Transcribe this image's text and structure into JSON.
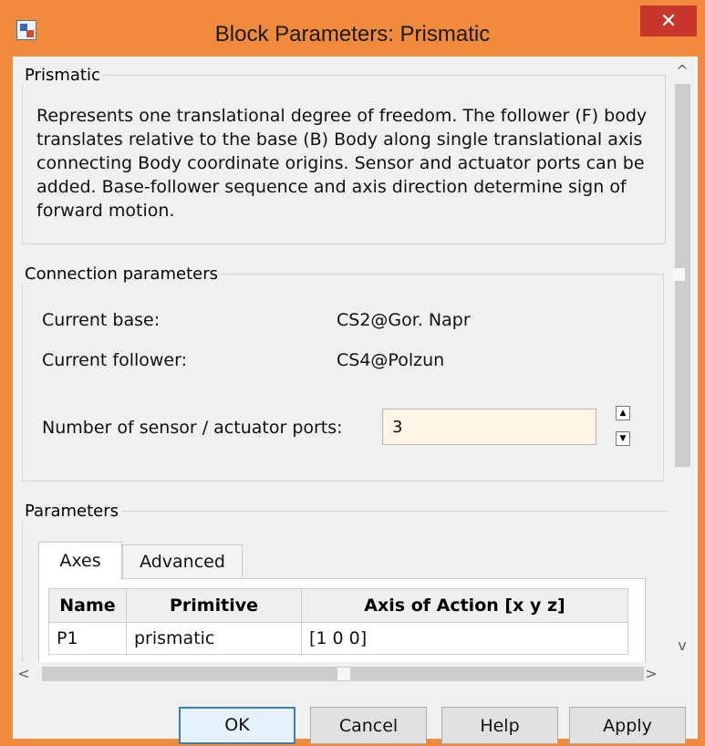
{
  "window": {
    "title": "Block Parameters: Prismatic",
    "close_glyph": "✕",
    "icon": "simulink-block-icon"
  },
  "block": {
    "group_label": "Prismatic",
    "description": "Represents one translational degree of freedom. The follower (F) body translates relative to the base (B) Body along single translational axis connecting Body coordinate origins. Sensor and actuator ports can be added. Base-follower sequence and axis direction determine sign of forward motion."
  },
  "connection": {
    "group_label": "Connection parameters",
    "base_label": "Current base:",
    "base_value": "CS2@Gor. Napr",
    "follower_label": "Current follower:",
    "follower_value": "CS4@Polzun",
    "ports_label": "Number of sensor / actuator ports:",
    "ports_value": "3",
    "spin_up": "▲",
    "spin_down": "▼"
  },
  "parameters": {
    "group_label": "Parameters",
    "tabs": [
      {
        "label": "Axes",
        "active": true
      },
      {
        "label": "Advanced",
        "active": false
      }
    ],
    "table": {
      "columns": [
        "Name",
        "Primitive",
        "Axis of Action [x y z]"
      ],
      "rows": [
        [
          "P1",
          "prismatic",
          "[1 0 0]"
        ]
      ]
    }
  },
  "scrollbars": {
    "up": "^",
    "down": "v",
    "left": "<",
    "right": ">"
  },
  "buttons": {
    "ok": "OK",
    "cancel": "Cancel",
    "help": "Help",
    "apply": "Apply"
  },
  "colors": {
    "frame": "#f08a3c",
    "close": "#c7372c",
    "input_bg": "#fff5e6",
    "default_button_border": "#3c7fb1"
  }
}
